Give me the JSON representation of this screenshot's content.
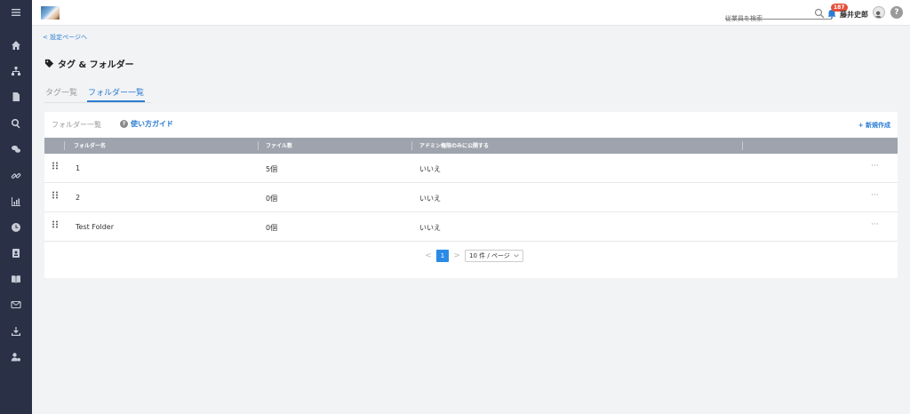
{
  "header": {
    "search_placeholder": "従業員を検索",
    "notification_count": "187",
    "username": "藤井史郎",
    "help_label": "?"
  },
  "back_link": "< 設定ページへ",
  "page_title": "タグ & フォルダー",
  "tabs": [
    {
      "label": "タグ一覧",
      "active": false
    },
    {
      "label": "フォルダー一覧",
      "active": true
    }
  ],
  "card": {
    "heading": "フォルダー一覧",
    "guide_label": "使い方ガイド",
    "guide_icon": "?",
    "new_label": "+ 新規作成"
  },
  "table": {
    "columns": [
      "フォルダー名",
      "ファイル数",
      "アドミン権限のみに公開する"
    ],
    "rows": [
      {
        "name": "1",
        "count": "5個",
        "admin_only": "いいえ",
        "more": "···"
      },
      {
        "name": "2",
        "count": "0個",
        "admin_only": "いいえ",
        "more": "···"
      },
      {
        "name": "Test Folder",
        "count": "0個",
        "admin_only": "いいえ",
        "more": "···"
      }
    ]
  },
  "pagination": {
    "prev": "<",
    "current": "1",
    "next": ">",
    "page_size": "10 件 / ページ"
  },
  "colors": {
    "sidebar": "#2a3147",
    "accent": "#2b7cd3",
    "table_header": "#9ea3ad",
    "badge": "#e4503a"
  },
  "icons": {
    "sidebar": [
      "menu-icon",
      "home-icon",
      "org-chart-icon",
      "document-icon",
      "search-icon",
      "chat-icon",
      "link-icon",
      "chart-icon",
      "clock-icon",
      "contacts-icon",
      "book-icon",
      "mail-icon",
      "download-icon",
      "user-settings-icon"
    ]
  }
}
